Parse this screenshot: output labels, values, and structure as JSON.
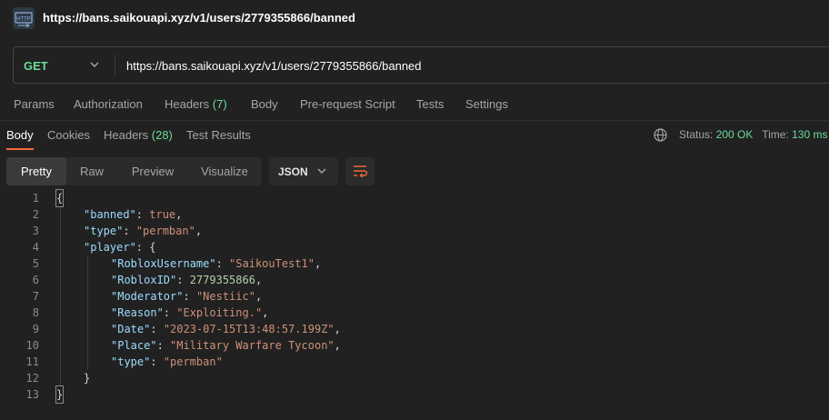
{
  "header": {
    "title": "https://bans.saikouapi.xyz/v1/users/2779355866/banned",
    "icon": "http-icon"
  },
  "request": {
    "method": "GET",
    "url": "https://bans.saikouapi.xyz/v1/users/2779355866/banned"
  },
  "request_tabs": [
    {
      "label": "Params"
    },
    {
      "label": "Authorization"
    },
    {
      "label": "Headers",
      "count": "(7)"
    },
    {
      "label": "Body"
    },
    {
      "label": "Pre-request Script"
    },
    {
      "label": "Tests"
    },
    {
      "label": "Settings"
    }
  ],
  "response_tabs": [
    {
      "label": "Body"
    },
    {
      "label": "Cookies"
    },
    {
      "label": "Headers",
      "count": "(28)"
    },
    {
      "label": "Test Results"
    }
  ],
  "status": {
    "status_label": "Status:",
    "status_value": "200 OK",
    "time_label": "Time:",
    "time_value": "130 ms"
  },
  "view_modes": [
    "Pretty",
    "Raw",
    "Preview",
    "Visualize"
  ],
  "format": "JSON",
  "colors": {
    "accent": "#f26b3a",
    "success": "#6bdd9a",
    "key": "#9cdcfe",
    "string": "#ce9178"
  },
  "code": {
    "line_numbers": [
      "1",
      "2",
      "3",
      "4",
      "5",
      "6",
      "7",
      "8",
      "9",
      "10",
      "11",
      "12",
      "13"
    ],
    "l1": "{",
    "k_banned": "\"banned\"",
    "v_banned": "true",
    "k_type": "\"type\"",
    "v_type": "\"permban\"",
    "k_player": "\"player\"",
    "v_player_open": "{",
    "k_user": "\"RobloxUsername\"",
    "v_user": "\"SaikouTest1\"",
    "k_id": "\"RobloxID\"",
    "v_id": "2779355866",
    "k_mod": "\"Moderator\"",
    "v_mod": "\"Nestiic\"",
    "k_reason": "\"Reason\"",
    "v_reason": "\"Exploiting.\"",
    "k_date": "\"Date\"",
    "v_date": "\"2023-07-15T13:48:57.199Z\"",
    "k_place": "\"Place\"",
    "v_place": "\"Military Warfare Tycoon\"",
    "k_ptype": "\"type\"",
    "v_ptype": "\"permban\"",
    "l12": "}",
    "l13": "}"
  }
}
